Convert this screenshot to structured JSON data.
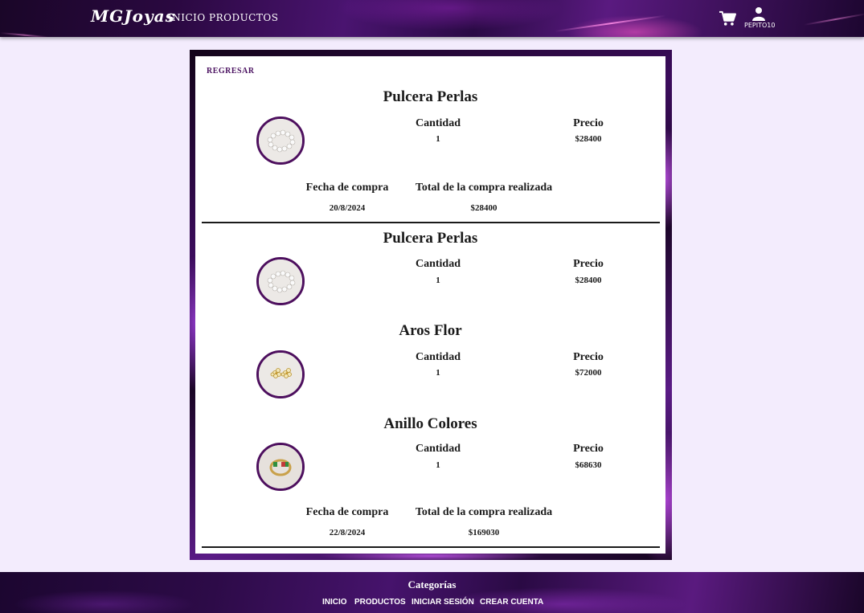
{
  "header": {
    "logo": "MGJoyas",
    "nav": [
      "INICIO",
      "PRODUCTOS"
    ],
    "user_name": "PEPITO10",
    "icons": [
      "cart-icon",
      "user-icon"
    ],
    "accent_color": "#4d0f5e"
  },
  "back_label": "REGRESAR",
  "labels": {
    "quantity": "Cantidad",
    "price": "Precio",
    "purchase_date": "Fecha de compra",
    "purchase_total": "Total de la compra realizada"
  },
  "orders": [
    {
      "items": [
        {
          "name": "Pulcera Perlas",
          "quantity": "1",
          "price": "$28400",
          "image": "pearl-bracelet"
        }
      ],
      "date": "20/8/2024",
      "total": "$28400"
    },
    {
      "items": [
        {
          "name": "Pulcera Perlas",
          "quantity": "1",
          "price": "$28400",
          "image": "pearl-bracelet"
        },
        {
          "name": "Aros Flor",
          "quantity": "1",
          "price": "$72000",
          "image": "flower-earrings"
        },
        {
          "name": "Anillo Colores",
          "quantity": "1",
          "price": "$68630",
          "image": "colored-ring"
        }
      ],
      "date": "22/8/2024",
      "total": "$169030"
    }
  ],
  "footer": {
    "title": "Categorías",
    "links": [
      "INICIO",
      "PRODUCTOS",
      "INICIAR SESIÓN",
      "CREAR CUENTA"
    ]
  }
}
